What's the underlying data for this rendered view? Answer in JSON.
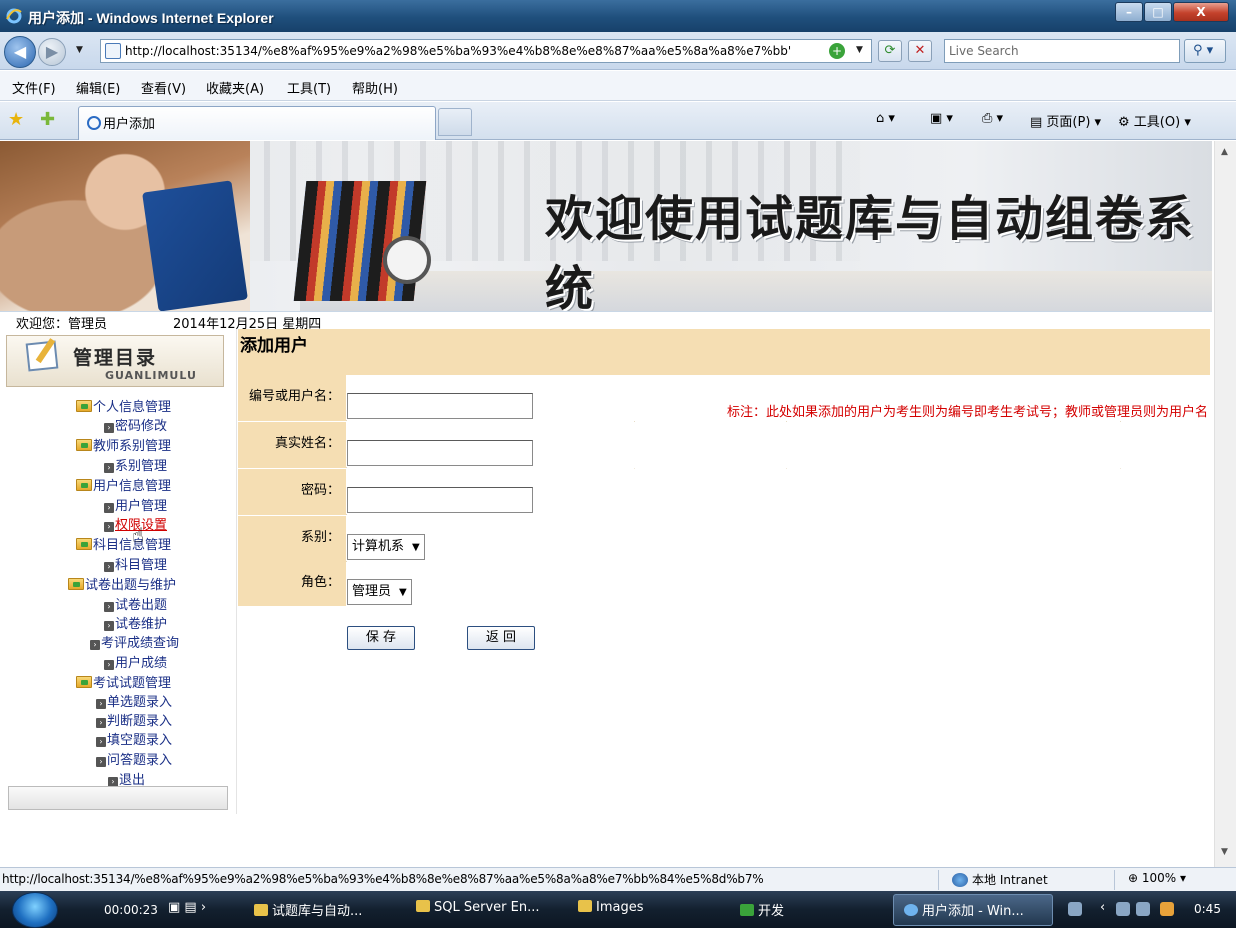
{
  "window": {
    "title": "用户添加 - Windows Internet Explorer",
    "minimize": "–",
    "maximize": "□",
    "close": "X"
  },
  "address_bar": {
    "url": "http://localhost:35134/%e8%af%95%e9%a2%98%e5%ba%93%e4%b8%8e%e8%87%aa%e5%8a%a8%e7%bb'",
    "search_placeholder": "Live Search"
  },
  "menu": [
    "文件(F)",
    "编辑(E)",
    "查看(V)",
    "收藏夹(A)",
    "工具(T)",
    "帮助(H)"
  ],
  "tab": {
    "label": "用户添加"
  },
  "command_bar": {
    "page": "页面(P)",
    "tools": "工具(O)"
  },
  "banner": {
    "title": "欢迎使用试题库与自动组卷系统"
  },
  "info": {
    "welcome": "欢迎您：管理员",
    "date": "2014年12月25日 星期四"
  },
  "sidebar": {
    "title": "管理目录",
    "subtitle": "GUANLIMULU",
    "items": [
      {
        "label": "个人信息管理",
        "type": "folder"
      },
      {
        "label": "密码修改",
        "type": "link"
      },
      {
        "label": "教师系别管理",
        "type": "folder"
      },
      {
        "label": "系别管理",
        "type": "link"
      },
      {
        "label": "用户信息管理",
        "type": "folder"
      },
      {
        "label": "用户管理",
        "type": "link"
      },
      {
        "label": "权限设置",
        "type": "link",
        "active": true
      },
      {
        "label": "科目信息管理",
        "type": "folder"
      },
      {
        "label": "科目管理",
        "type": "link"
      },
      {
        "label": "试卷出题与维护",
        "type": "folder"
      },
      {
        "label": "试卷出题",
        "type": "link"
      },
      {
        "label": "试卷维护",
        "type": "link"
      },
      {
        "label": "考评成绩查询",
        "type": "link"
      },
      {
        "label": "用户成绩",
        "type": "link"
      },
      {
        "label": "考试试题管理",
        "type": "folder"
      },
      {
        "label": "单选题录入",
        "type": "link"
      },
      {
        "label": "判断题录入",
        "type": "link"
      },
      {
        "label": "填空题录入",
        "type": "link"
      },
      {
        "label": "问答题录入",
        "type": "link"
      },
      {
        "label": "退出",
        "type": "link"
      }
    ]
  },
  "form": {
    "title": "添加用户",
    "fields": {
      "username_label": "编号或用户名：",
      "username_value": "",
      "realname_label": "真实姓名：",
      "realname_value": "",
      "password_label": "密码：",
      "password_value": "",
      "dept_label": "系别：",
      "dept_value": "计算机系",
      "role_label": "角色：",
      "role_value": "管理员"
    },
    "remark": "标注：此处如果添加的用户为考生则为编号即考生考试号；教师或管理员则为用户名",
    "save_button": "保 存",
    "back_button": "返 回"
  },
  "status_bar": {
    "url": "http://localhost:35134/%e8%af%95%e9%a2%98%e5%ba%93%e4%b8%8e%e8%87%aa%e5%8a%a8%e7%bb%84%e5%8d%b7%",
    "zone": "本地 Intranet",
    "zoom": "100%"
  },
  "taskbar": {
    "timer": "00:00:23",
    "tasks": [
      "试题库与自动...",
      "SQL Server En...",
      "Images",
      "开发",
      "用户添加 - Win..."
    ],
    "clock": "0:45"
  }
}
